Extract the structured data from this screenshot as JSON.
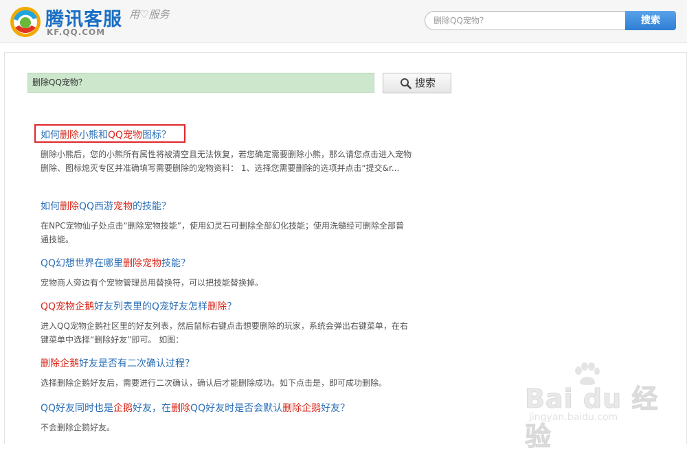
{
  "header": {
    "logo_text": "腾讯客服",
    "logo_domain": "KF.QQ.COM",
    "slogan": "用♡服务",
    "search_placeholder": "删除QQ宠物？",
    "search_button": "搜索"
  },
  "main_search": {
    "query": "删除QQ宠物？",
    "button_label": "搜索"
  },
  "results": [
    {
      "title": [
        {
          "t": "如何",
          "hl": false
        },
        {
          "t": "删除",
          "hl": true
        },
        {
          "t": "小熊和",
          "hl": false
        },
        {
          "t": "QQ宠物",
          "hl": true
        },
        {
          "t": "图标？",
          "hl": false
        }
      ],
      "snippet": "删除小熊后，您的小熊所有属性将被清空且无法恢复，若您确定需要删除小熊，那么请您点击进入宠物删除、图标熄灭专区并准确填写需要删除的宠物资料： 1、选择您需要删除的选项并点击“提交&r..."
    },
    {
      "title": [
        {
          "t": "如何",
          "hl": false
        },
        {
          "t": "删除",
          "hl": true
        },
        {
          "t": "QQ西游",
          "hl": false
        },
        {
          "t": "宠物",
          "hl": true
        },
        {
          "t": "的技能？",
          "hl": false
        }
      ],
      "snippet": "在NPC宠物仙子处点击“删除宠物技能”，使用幻灵石可删除全部幻化技能；使用洗髓经可删除全部普通技能。"
    },
    {
      "title": [
        {
          "t": "QQ幻想世界在哪里",
          "hl": false
        },
        {
          "t": "删除宠物",
          "hl": true
        },
        {
          "t": "技能？",
          "hl": false
        }
      ],
      "snippet": "宠物商人旁边有个宠物管理员用替换符，可以把技能替换掉。"
    },
    {
      "title": [
        {
          "t": "QQ宠物企鹅",
          "hl": true
        },
        {
          "t": "好友列表里的Q宠好友怎样",
          "hl": false
        },
        {
          "t": "删除",
          "hl": true
        },
        {
          "t": "？",
          "hl": false
        }
      ],
      "snippet": "进入QQ宠物企鹅社区里的好友列表，然后鼠标右键点击想要删除的玩家，系统会弹出右键菜单，在右键菜单中选择“删除好友”即可。 如图："
    },
    {
      "title": [
        {
          "t": "删除企鹅",
          "hl": true
        },
        {
          "t": "好友是否有二次确认过程？",
          "hl": false
        }
      ],
      "snippet": "选择删除企鹅好友后，需要进行二次确认，确认后才能删除成功。如下点击是，即可成功删除。"
    },
    {
      "title": [
        {
          "t": "QQ好友同时也是",
          "hl": false
        },
        {
          "t": "企鹅",
          "hl": true
        },
        {
          "t": "好友，在",
          "hl": false
        },
        {
          "t": "删除",
          "hl": true
        },
        {
          "t": "QQ好友时是否会默认",
          "hl": false
        },
        {
          "t": "删除企鹅",
          "hl": true
        },
        {
          "t": "好友？",
          "hl": false
        }
      ],
      "snippet": "不会删除企鹅好友。"
    }
  ],
  "watermark": {
    "text": "Bai du 经验",
    "sub": "jingyan.baidu.com"
  },
  "colors": {
    "link": "#2b6fb6",
    "highlight": "#d8281c",
    "annotation_box": "#e0262b",
    "search_button": "#3a8de0"
  }
}
